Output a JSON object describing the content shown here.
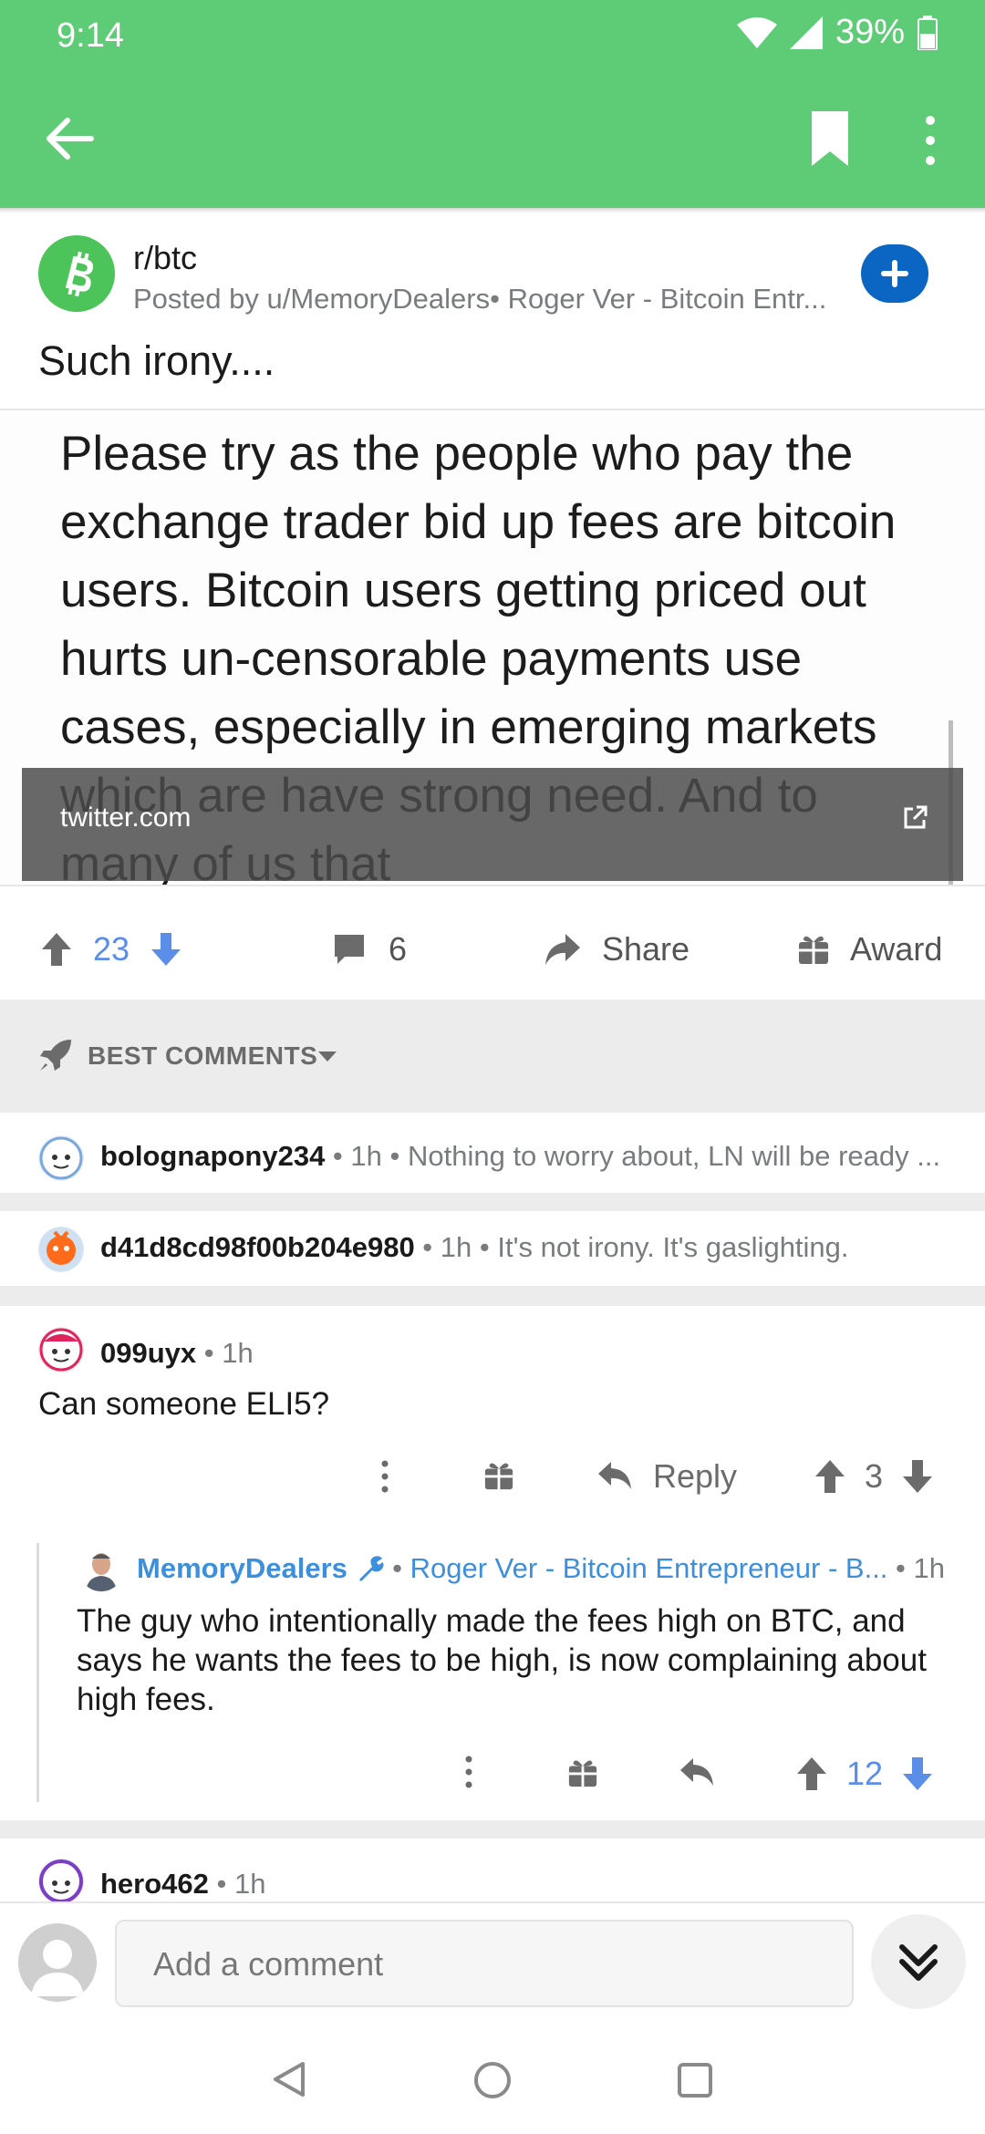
{
  "status": {
    "time": "9:14",
    "battery": "39%",
    "icons": [
      "wifi-icon",
      "signal-icon",
      "battery-icon"
    ]
  },
  "toolbar": {
    "back_icon": "arrow-left-icon",
    "bookmark_icon": "bookmark-icon",
    "more_icon": "kebab-menu-icon"
  },
  "post": {
    "subreddit": "r/btc",
    "meta": "Posted by u/MemoryDealers• Roger Ver - Bitcoin Entr...",
    "title": "Such irony....",
    "embed": {
      "text": "Please try as the people who pay the exchange trader bid up fees are bitcoin users. Bitcoin users getting priced out hurts un-censorable payments use cases, especially in emerging markets which are have strong need. And to many of us that",
      "domain": "twitter.com"
    },
    "actions": {
      "score": "23",
      "comments": "6",
      "share": "Share",
      "award": "Award"
    }
  },
  "sort": {
    "label": "BEST COMMENTS"
  },
  "comments": [
    {
      "author": "bolognapony234",
      "time": "1h",
      "snippet": "Nothing to worry about, LN will be ready ..."
    },
    {
      "author": "d41d8cd98f00b204e980",
      "time": "1h",
      "snippet": "It's not irony. It's gaslighting."
    },
    {
      "author": "099uyx",
      "time": "1h",
      "body": "Can someone ELI5?",
      "reply": "Reply",
      "score": "3"
    },
    {
      "author": "MemoryDealers",
      "flair": "Roger Ver - Bitcoin Entrepreneur - B...",
      "time": "1h",
      "body": "The guy who intentionally made the fees high on BTC, and says he wants the fees to be high, is now complaining about high fees.",
      "score": "12"
    },
    {
      "author": "hero462",
      "time": "1h"
    }
  ],
  "composer": {
    "placeholder": "Add a comment"
  },
  "colors": {
    "header": "#5ecb77",
    "accent_blue": "#0a66c2",
    "upvote_blue": "#5a8ee8"
  }
}
